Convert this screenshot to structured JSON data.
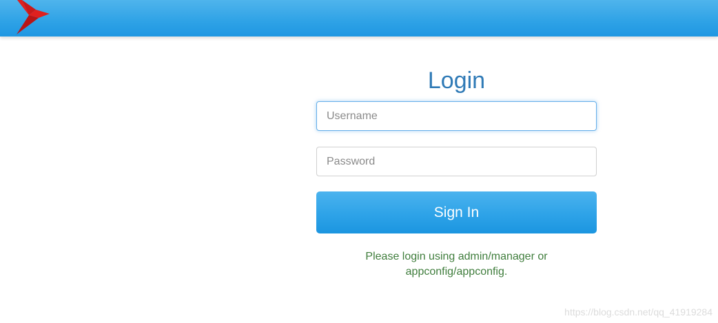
{
  "header": {
    "logo_icon": "red-bird-logo-icon",
    "brand_color": "#2ea2e6"
  },
  "login": {
    "title": "Login",
    "username": {
      "placeholder": "Username",
      "value": ""
    },
    "password": {
      "placeholder": "Password",
      "value": ""
    },
    "signin_label": "Sign In",
    "hint_line1": "Please login using admin/manager or",
    "hint_line2": "appconfig/appconfig.",
    "title_color": "#2f7ab6",
    "hint_color": "#3f7d3c"
  },
  "watermark": "https://blog.csdn.net/qq_41919284"
}
